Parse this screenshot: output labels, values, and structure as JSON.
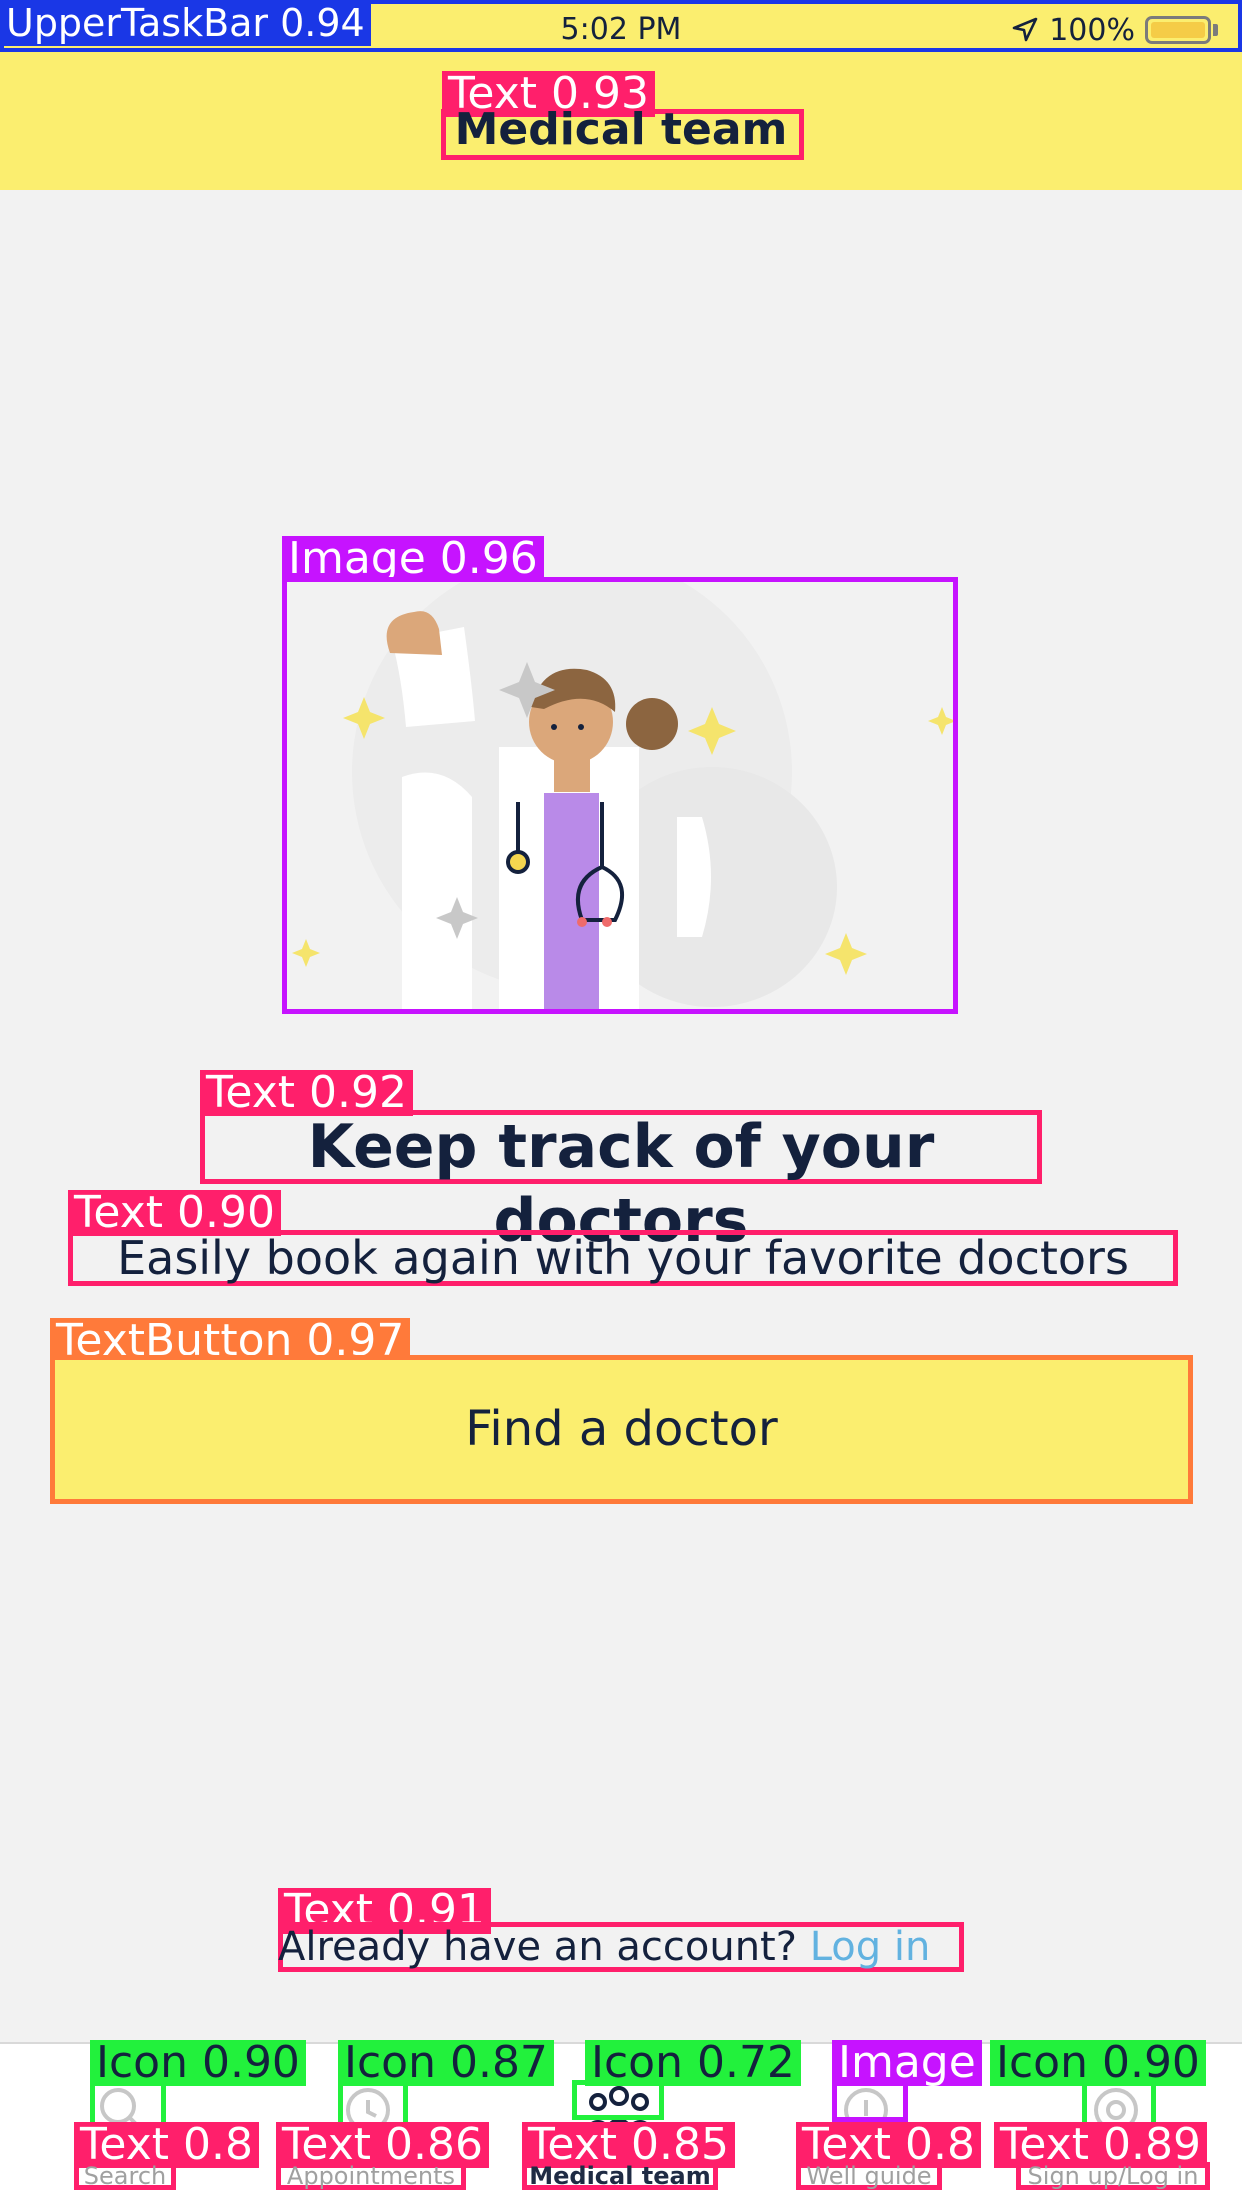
{
  "status_bar": {
    "time": "5:02 PM",
    "battery": "100%"
  },
  "header": {
    "title": "Medical team"
  },
  "annotations": {
    "upper_taskbar": "UpperTaskBar 0.94",
    "title_text": "Text 0.93",
    "image": "Image 0.96",
    "headline_text": "Text 0.92",
    "subtext_text": "Text 0.90",
    "button": "TextButton 0.97",
    "account_text": "Text 0.91",
    "tab_icons": [
      "Icon 0.90",
      "Icon 0.87",
      "Icon 0.72",
      "Image",
      "Icon 0.90"
    ],
    "tab_texts": [
      "Text 0.8",
      "Text 0.86",
      "Text 0.85",
      "Text 0.8",
      "Text 0.89"
    ]
  },
  "content": {
    "headline": "Keep track of your doctors",
    "subtext": "Easily book again with your favorite doctors",
    "cta_label": "Find a doctor",
    "account_prompt": "Already have an account?",
    "login_link": "Log in"
  },
  "tabs": [
    {
      "label": "Search",
      "icon": "search-icon",
      "active": false
    },
    {
      "label": "Appointments",
      "icon": "clock-icon",
      "active": false
    },
    {
      "label": "Medical team",
      "icon": "team-icon",
      "active": true
    },
    {
      "label": "Well guide",
      "icon": "guide-icon",
      "active": false
    },
    {
      "label": "Sign up/Log in",
      "icon": "user-icon",
      "active": false
    }
  ],
  "colors": {
    "brand_yellow": "#fbee6f",
    "text_dark": "#14213d",
    "link_blue": "#62b2e0",
    "annotation_pink": "#ff1f6b",
    "annotation_orange": "#ff7a3a",
    "annotation_purple": "#c613ff",
    "annotation_green": "#22f13c",
    "annotation_blue": "#1a37e6"
  }
}
